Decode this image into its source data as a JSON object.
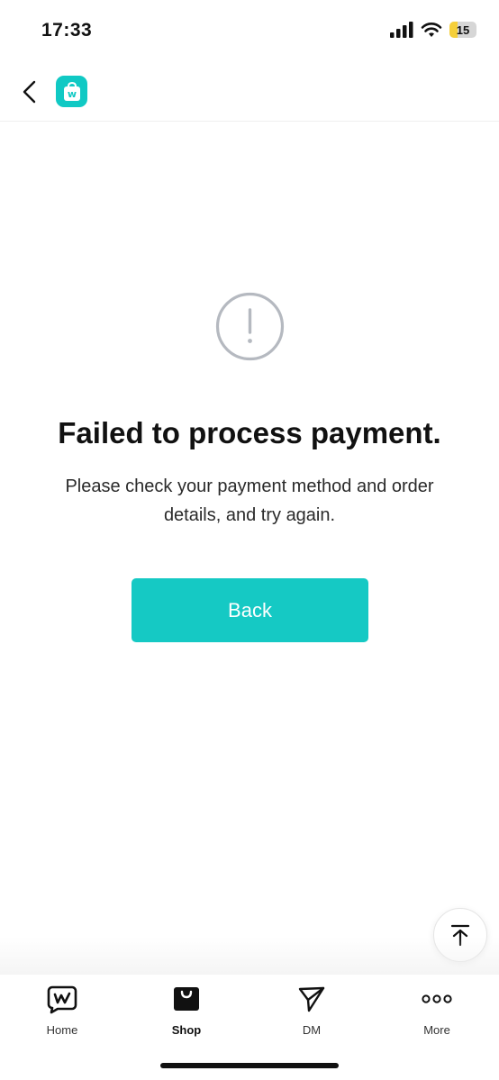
{
  "status_bar": {
    "time": "17:33",
    "battery_level": "15",
    "icons": [
      "signal-icon",
      "wifi-icon",
      "battery-icon"
    ]
  },
  "header": {
    "back_icon": "chevron-left-icon",
    "logo_letter": "w"
  },
  "error": {
    "icon": "exclamation-circle-icon",
    "title": "Failed to process payment.",
    "message": "Please check your payment method and order details, and try again.",
    "button_label": "Back"
  },
  "scroll_top": {
    "icon": "arrow-up-to-line-icon"
  },
  "tab_bar": {
    "active": "Shop",
    "items": [
      {
        "label": "Home",
        "icon": "weverse-home-icon"
      },
      {
        "label": "Shop",
        "icon": "shopping-bag-icon"
      },
      {
        "label": "DM",
        "icon": "paper-plane-icon"
      },
      {
        "label": "More",
        "icon": "more-dots-icon"
      }
    ]
  },
  "colors": {
    "accent": "#15c9c4",
    "icon_gray": "#b5b9c0",
    "text": "#111111"
  }
}
